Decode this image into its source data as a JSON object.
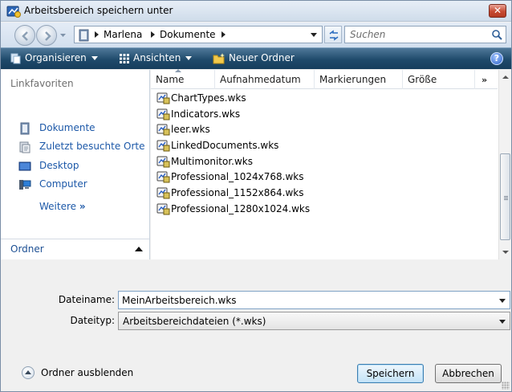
{
  "window": {
    "title": "Arbeitsbereich speichern unter"
  },
  "address": {
    "crumbs": [
      "Marlena",
      "Dokumente"
    ],
    "search_placeholder": "Suchen"
  },
  "toolbar": {
    "organize": "Organisieren",
    "views": "Ansichten",
    "new_folder": "Neuer Ordner"
  },
  "navpane": {
    "heading": "Linkfavoriten",
    "favorites": [
      {
        "label": "Dokumente",
        "icon": "documents-icon"
      },
      {
        "label": "Zuletzt besuchte Orte",
        "icon": "recent-places-icon"
      },
      {
        "label": "Desktop",
        "icon": "desktop-icon"
      },
      {
        "label": "Computer",
        "icon": "computer-icon"
      }
    ],
    "more": "Weitere",
    "folders": "Ordner"
  },
  "filelist": {
    "columns": [
      "Name",
      "Aufnahmedatum",
      "Markierungen",
      "Größe"
    ],
    "files": [
      "ChartTypes.wks",
      "Indicators.wks",
      "leer.wks",
      "LinkedDocuments.wks",
      "Multimonitor.wks",
      "Professional_1024x768.wks",
      "Professional_1152x864.wks",
      "Professional_1280x1024.wks"
    ]
  },
  "form": {
    "filename_label": "Dateiname:",
    "filename_value": "MeinArbeitsbereich.wks",
    "filetype_label": "Dateityp:",
    "filetype_value": "Arbeitsbereichdateien (*.wks)"
  },
  "footer": {
    "hide_folders": "Ordner ausblenden",
    "save": "Speichern",
    "cancel": "Abbrechen"
  }
}
